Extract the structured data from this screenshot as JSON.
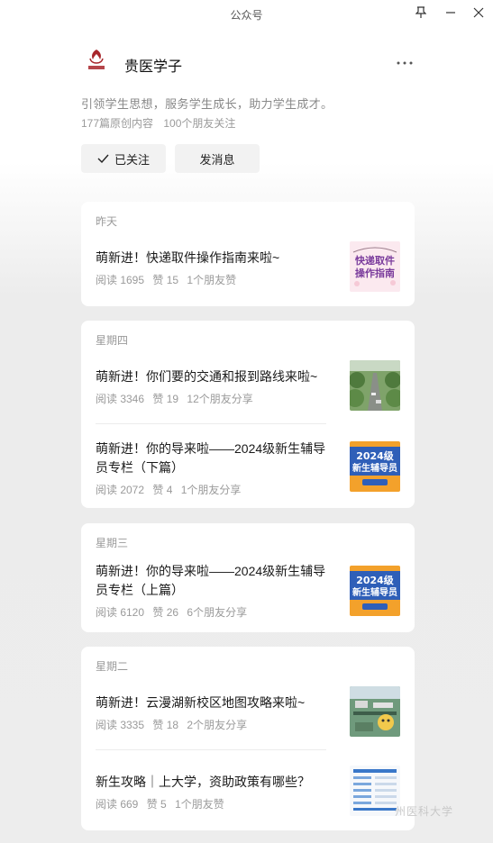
{
  "window": {
    "title": "公众号"
  },
  "account": {
    "name": "贵医学子",
    "description": "引领学生思想，服务学生成长，助力学生成才。",
    "original_count": "177篇原创内容",
    "friends_following": "100个朋友关注",
    "follow_label": "已关注",
    "message_label": "发消息"
  },
  "groups": [
    {
      "day": "昨天",
      "articles": [
        {
          "title": "萌新进！快递取件操作指南来啦~",
          "reads": "阅读 1695",
          "likes": "赞 15",
          "social": "1个朋友赞",
          "thumb_text": "快递取件\n操作指南"
        }
      ]
    },
    {
      "day": "星期四",
      "articles": [
        {
          "title": "萌新进！你们要的交通和报到路线来啦~",
          "reads": "阅读 3346",
          "likes": "赞 19",
          "social": "12个朋友分享"
        },
        {
          "title": "萌新进！你的导来啦——2024级新生辅导员专栏（下篇）",
          "reads": "阅读 2072",
          "likes": "赞 4",
          "social": "1个朋友分享",
          "thumb_text": "2024级\n新生辅导员"
        }
      ]
    },
    {
      "day": "星期三",
      "articles": [
        {
          "title": "萌新进！你的导来啦——2024级新生辅导员专栏（上篇）",
          "reads": "阅读 6120",
          "likes": "赞 26",
          "social": "6个朋友分享",
          "thumb_text": "2024级\n新生辅导员"
        }
      ]
    },
    {
      "day": "星期二",
      "articles": [
        {
          "title": "萌新进！云漫湖新校区地图攻略来啦~",
          "reads": "阅读 3335",
          "likes": "赞 18",
          "social": "2个朋友分享"
        },
        {
          "title": "新生攻略｜上大学，资助政策有哪些？",
          "reads": "阅读 669",
          "likes": "赞 5",
          "social": "1个朋友赞"
        }
      ]
    }
  ],
  "watermark": "州医科大学",
  "colors": {
    "background_bottom": "#ededed",
    "card": "#ffffff",
    "accent_blue": "#2f5fb8",
    "accent_orange": "#f3a12b"
  }
}
